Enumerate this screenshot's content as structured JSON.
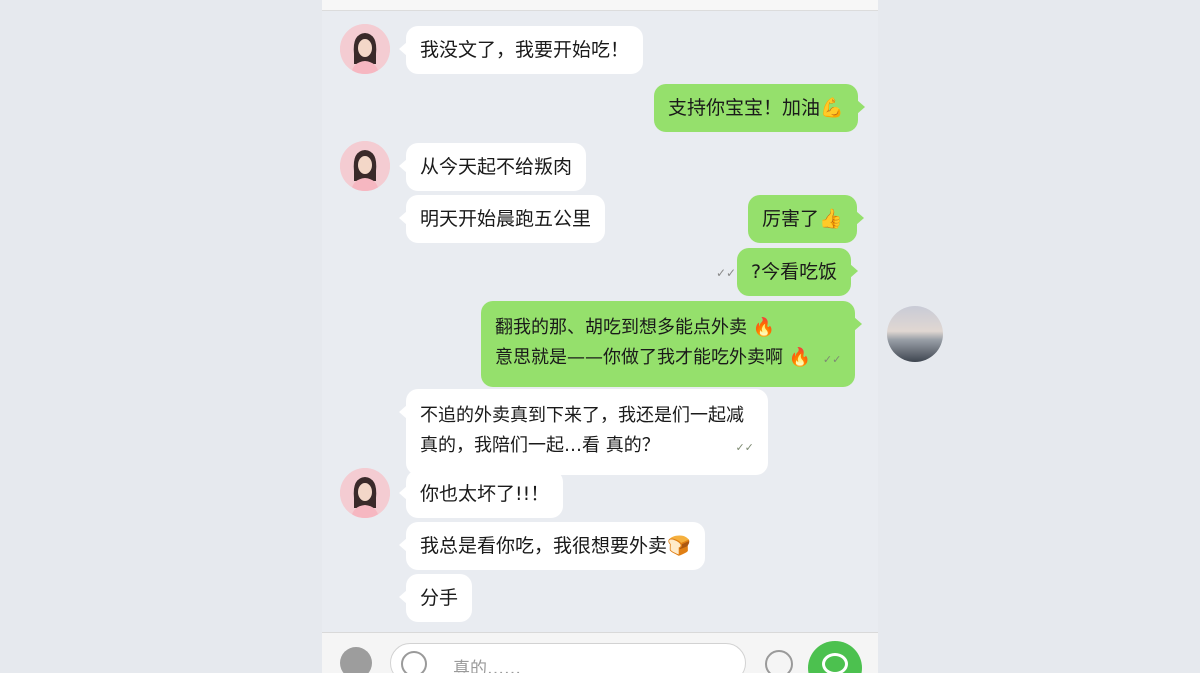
{
  "messages": [
    {
      "side": "left",
      "text": "我没文了，我要开始吃！"
    },
    {
      "side": "right",
      "text": "支持你宝宝！加油",
      "emoji": "💪"
    },
    {
      "side": "left",
      "text": "从今天起不给叛肉"
    },
    {
      "side": "left",
      "text": "明天开始晨跑五公里"
    },
    {
      "side": "right",
      "text": "厉害了",
      "emoji": "👍"
    },
    {
      "side": "right",
      "text": "?今看吃饭"
    },
    {
      "side": "right",
      "line1": "翻我的那、胡吃到想多能点外卖",
      "line2": "意思就是——你做了我才能吃外卖啊",
      "emoji1": "🔥",
      "emoji2": "🔥",
      "meta": "✓✓"
    },
    {
      "side": "left",
      "line1": "不追的外卖真到下来了，我还是们一起减",
      "line2": "真的，我陪们一起…看 真的？",
      "meta": "✓✓"
    },
    {
      "side": "left",
      "text": "你也太坏了!!！"
    },
    {
      "side": "left",
      "text": "我总是看你吃，我很想要外卖",
      "emoji": "🍞"
    },
    {
      "side": "left",
      "text": "分手"
    }
  ],
  "small_meta": "✓✓",
  "input": {
    "placeholder": "真的……"
  },
  "colors": {
    "sent_bubble": "#95e06c",
    "received_bubble": "#ffffff",
    "background": "#e9ecf1",
    "send_button": "#4cc14f"
  },
  "icons": {
    "voice": "voice-icon",
    "emoji": "emoji-icon",
    "clock": "clock-icon",
    "send": "send-icon"
  }
}
